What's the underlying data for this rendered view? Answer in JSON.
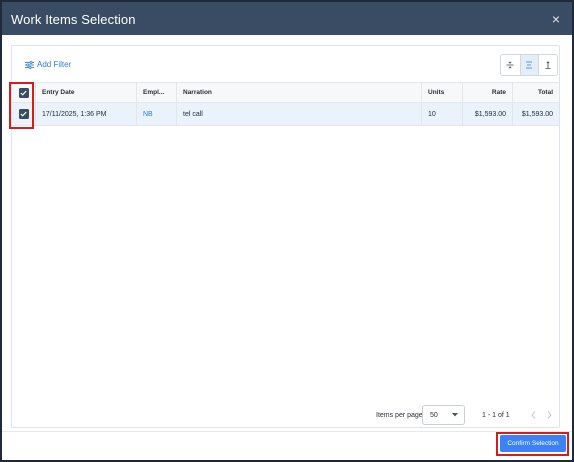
{
  "dialog": {
    "title": "Work Items Selection",
    "close_label": "×"
  },
  "toolbar": {
    "add_filter_label": "Add Filter",
    "density_buttons": [
      {
        "icon": "density-compact-icon"
      },
      {
        "icon": "density-standard-icon",
        "active": true
      },
      {
        "icon": "density-comfortable-icon"
      }
    ]
  },
  "grid": {
    "columns": [
      "Entry Date",
      "Empl...",
      "Narration",
      "Units",
      "Rate",
      "Total"
    ],
    "rows": [
      {
        "selected": true,
        "entry_date": "17/11/2025, 1:36 PM",
        "employee": "NB",
        "narration": "tel call",
        "units": "10",
        "rate": "$1,593.00",
        "total": "$1,593.00"
      }
    ]
  },
  "pagination": {
    "items_per_page_label": "Items per page",
    "items_per_page_value": "50",
    "range_text": "1 - 1 of 1"
  },
  "footer": {
    "confirm_label": "Confirm Selection"
  },
  "colors": {
    "header_bg": "#3a4c63",
    "accent": "#3b82f6",
    "link": "#2e7bd6",
    "highlight": "#d11f1f",
    "selected_row": "#eaf2fc"
  }
}
